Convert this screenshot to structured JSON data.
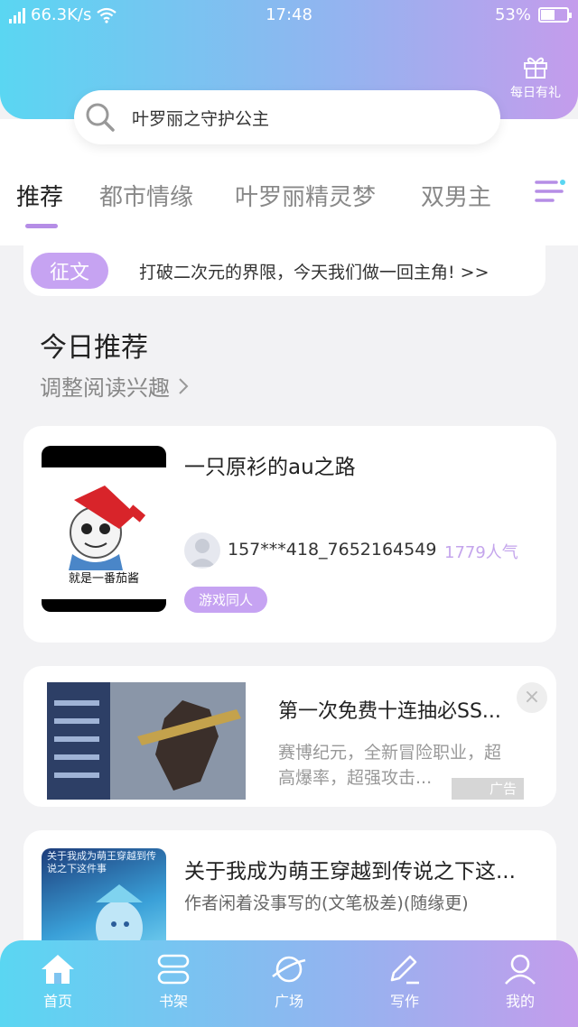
{
  "status_bar": {
    "network": "4G",
    "speed": "66.3K/s",
    "time": "17:48",
    "battery": "53%",
    "battery_level": 0.53
  },
  "header": {
    "gift_label": "每日有礼",
    "search_text": "叶罗丽之守护公主"
  },
  "tabs": [
    {
      "label": "推荐",
      "active": true
    },
    {
      "label": "都市情缘",
      "active": false
    },
    {
      "label": "叶罗丽精灵梦",
      "active": false
    },
    {
      "label": "双男主",
      "active": false
    }
  ],
  "notice": {
    "tag": "征文",
    "text": "打破二次元的界限，今天我们做一回主角! >>"
  },
  "recommend": {
    "title": "今日推荐",
    "subtitle": "调整阅读兴趣"
  },
  "books": [
    {
      "title": "一只原衫的au之路",
      "cover_caption": "就是一番茄酱",
      "author": "157***418_7652164549",
      "popularity": "1779人气",
      "tag": "游戏同人"
    },
    {
      "title": "关于我成为萌王穿越到传说之下这...",
      "cover_caption": "关于我成为萌王穿越到传说之下这件事",
      "description": "作者闲着没事写的(文笔极差)(随缘更)"
    }
  ],
  "ad": {
    "title": "第一次免费十连抽必SS...",
    "description": "赛博纪元，全新冒险职业，超高爆率，超强攻击...",
    "badge": "广告",
    "close": "×"
  },
  "bottom_nav": [
    {
      "label": "首页",
      "icon": "home-icon"
    },
    {
      "label": "书架",
      "icon": "bookshelf-icon"
    },
    {
      "label": "广场",
      "icon": "planet-icon"
    },
    {
      "label": "写作",
      "icon": "pen-icon"
    },
    {
      "label": "我的",
      "icon": "profile-icon"
    }
  ],
  "colors": {
    "gradient_start": "#5ad6f2",
    "gradient_end": "#c49cec",
    "accent": "#c6a3f2"
  }
}
